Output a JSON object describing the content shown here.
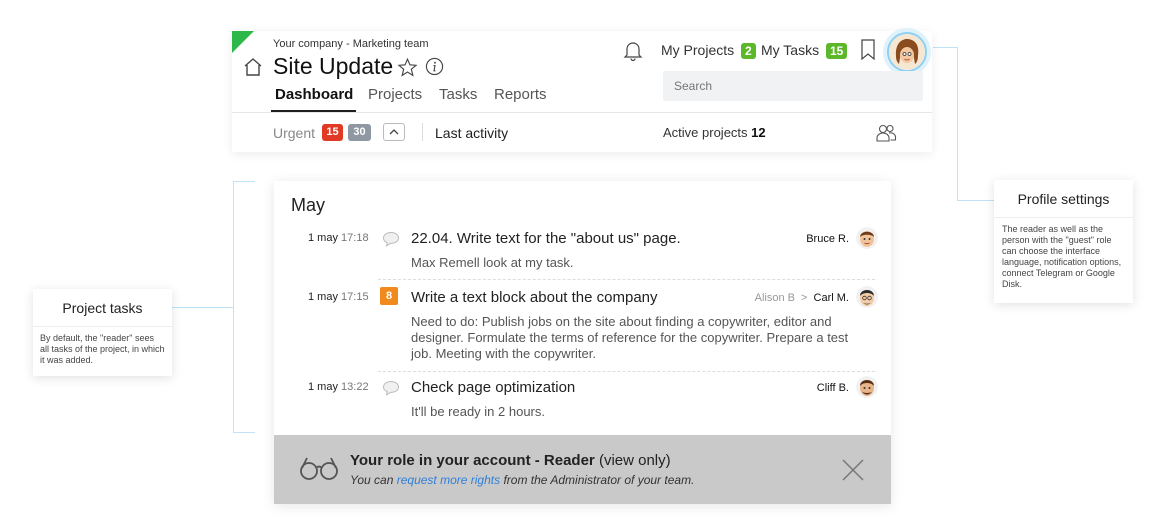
{
  "header": {
    "breadcrumb": "Your company - Marketing team",
    "title": "Site Update",
    "tabs": [
      {
        "label": "Dashboard",
        "active": true
      },
      {
        "label": "Projects"
      },
      {
        "label": "Tasks"
      },
      {
        "label": "Reports"
      }
    ],
    "my_projects_label": "My Projects",
    "my_projects_count": "2",
    "my_tasks_label": "My Tasks",
    "my_tasks_count": "15",
    "search_placeholder": "Search"
  },
  "filter_bar": {
    "urgent_label": "Urgent",
    "urgent_red": "15",
    "urgent_grey": "30",
    "last_activity_label": "Last activity",
    "active_projects_label": "Active projects",
    "active_projects_count": "12"
  },
  "activity": {
    "month": "May",
    "items": [
      {
        "date": "1 may",
        "time": "17:18",
        "indicator": "comment-icon",
        "title": "22.04. Write text for the \"about us\" page.",
        "body": "Max Remell look at my task.",
        "from": "",
        "assignee": "Bruce R."
      },
      {
        "date": "1 may",
        "time": "17:15",
        "indicator": "count-badge",
        "badge": "8",
        "title": "Write a text block about the company",
        "body": "Need to do: Publish jobs on the site about finding a copywriter, editor and designer. Formulate the terms of reference for the copywriter. Prepare a test job. Meeting with the copywriter.",
        "from": "Alison B",
        "arrow": ">",
        "assignee": "Carl M."
      },
      {
        "date": "1 may",
        "time": "13:22",
        "indicator": "comment-icon",
        "title": "Check page optimization",
        "body": "It'll be ready in 2 hours.",
        "from": "",
        "assignee": "Cliff B."
      }
    ]
  },
  "role_banner": {
    "title_bold": "Your role in your account - Reader",
    "title_rest": " (view only)",
    "desc_before": "You can ",
    "desc_link": "request more rights",
    "desc_after": " from the Administrator of your team."
  },
  "callouts": {
    "profile": {
      "title": "Profile settings",
      "body": "The reader as well as the person with the \"guest\" role can choose the interface language, notification options, connect Telegram or Google Disk."
    },
    "tasks": {
      "title": "Project tasks",
      "body": "By default, the \"reader\" sees all tasks of the project, in which it was added."
    }
  },
  "colors": {
    "accent_green": "#5cb82a",
    "urgent_red": "#e03a24",
    "badge_grey": "#8f97a3",
    "task_orange": "#f08a1c",
    "link_blue": "#2f7fd8",
    "callout_line": "#bfe3f7"
  }
}
